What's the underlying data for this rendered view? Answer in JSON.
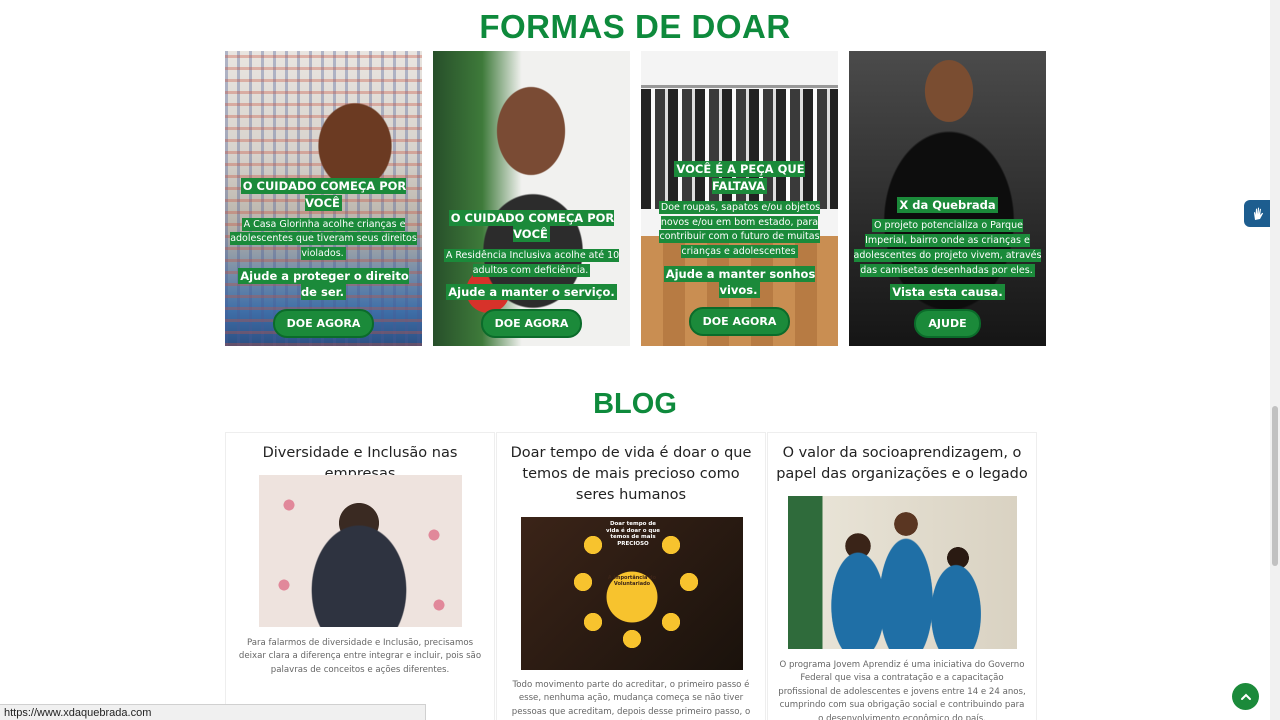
{
  "donate": {
    "title": "FORMAS DE DOAR",
    "cards": [
      {
        "headline": "O CUIDADO COMEÇA POR VOCÊ",
        "body": "A Casa Glorinha acolhe crianças e adolescentes que tiveram seus direitos violados.",
        "cta": "Ajude a proteger o direito de ser.",
        "button": "DOE AGORA"
      },
      {
        "headline": "O CUIDADO COMEÇA POR VOCÊ",
        "body": "A Residência Inclusiva acolhe até 10 adultos com deficiência.",
        "cta": "Ajude a manter o serviço.",
        "button": "DOE AGORA"
      },
      {
        "headline": "VOCÊ É A PEÇA QUE FALTAVA",
        "body": "Doe roupas, sapatos e/ou objetos novos e/ou em bom estado, para contribuir com o futuro de muitas crianças e adolescentes",
        "cta": "Ajude a manter sonhos vivos.",
        "button": "DOE AGORA"
      },
      {
        "headline": "X da Quebrada",
        "body": "O projeto potencializa o Parque Imperial, bairro onde as crianças e adolescentes do projeto vivem, através das camisetas desenhadas por eles.",
        "cta": "Vista esta causa.",
        "button": "AJUDE"
      }
    ]
  },
  "blog": {
    "title": "BLOG",
    "posts": [
      {
        "title": "Diversidade e Inclusão nas empresas",
        "excerpt": "Para falarmos de diversidade e Inclusão, precisamos deixar clara a diferença entre integrar e incluir, pois são palavras de conceitos e ações diferentes."
      },
      {
        "title": "Doar tempo de vida é doar o que temos de mais precioso como seres humanos",
        "excerpt": "Todo movimento parte do acreditar, o primeiro passo é esse, nenhuma ação, mudança começa se não tiver pessoas que acreditam, depois desse primeiro passo, o movimento é gerado",
        "infographic_title": "Doar tempo de vida é doar o que temos de mais PRECIOSO",
        "infographic_center": "A importância do Voluntariado"
      },
      {
        "title": "O valor da socioaprendizagem, o papel das organizações e o legado",
        "excerpt": "O programa Jovem Aprendiz é uma iniciativa do Governo Federal que visa a contratação e a capacitação profissional de adolescentes e jovens entre 14 e 24 anos, cumprindo com sua obrigação social e contribuindo para o desenvolvimento econômico do país."
      }
    ]
  },
  "status_bar": {
    "url": "https://www.xdaquebrada.com"
  },
  "widgets": {
    "accessibility_icon": "sign-language-hand-icon",
    "back_to_top_icon": "chevron-up-icon"
  },
  "colors": {
    "brand_green": "#0e8a3c",
    "button_green": "#1b8a3a",
    "accessibility_blue": "#1d5d8f"
  }
}
